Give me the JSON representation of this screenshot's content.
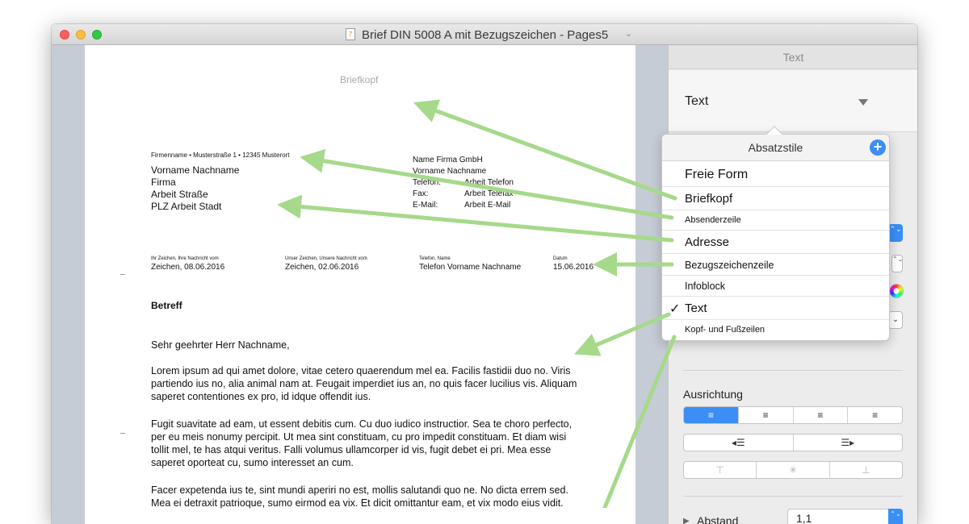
{
  "window": {
    "title": "Brief DIN 5008 A mit Bezugszeichen - Pages5",
    "chevron": "⌄",
    "doc_icon": "7"
  },
  "letter": {
    "header": "Briefkopf",
    "sender_line": "Firmenname • Musterstraße 1 • 12345 Musterort",
    "address": [
      "Vorname Nachname",
      "Firma",
      "Arbeit Straße",
      "PLZ Arbeit Stadt"
    ],
    "info_company": [
      "Name Firma GmbH",
      "Vorname Nachname"
    ],
    "info_labels": [
      "Telefon:",
      "Fax:",
      "E-Mail:"
    ],
    "info_values": [
      "Arbeit Telefon",
      "Arbeit Telefax",
      "Arbeit E-Mail"
    ],
    "ref_labels": [
      "Ihr Zeichen, Ihre Nachricht vom",
      "Unser Zeichen, Unsere Nachricht vom",
      "Telefon, Name",
      "Datum"
    ],
    "ref_values": [
      "Zeichen, 08.06.2016",
      "Zeichen, 02.06.2016",
      "Telefon Vorname Nachname",
      "15.06.2016"
    ],
    "subject": "Betreff",
    "salutation": "Sehr geehrter Herr Nachname,",
    "paragraphs": [
      [
        "Lorem ipsum ad qui amet dolore, vitae cetero quaerendum mel ea. Facilis fastidii duo no. Viris",
        "partiendo ius no, alia animal nam at. Feugait imperdiet ius an, no quis facer lucilius vis. Aliquam",
        "saperet contentiones ex pro, id idque offendit ius."
      ],
      [
        "Fugit suavitate ad eam, ut essent debitis cum. Cu duo iudico instructior. Sea te choro perfecto,",
        "per eu meis nonumy percipit. Ut mea sint constituam, cu pro impedit constituam. Et diam wisi",
        "tollit mel, te has atqui veritus. Falli volumus ullamcorper id vis, fugit debet ei pri. Mea esse",
        "saperet oporteat cu, sumo interesset an cum."
      ],
      [
        "Facer expetenda ius te, sint mundi aperiri no est, mollis salutandi quo ne. No dicta errem sed.",
        "Mea ei detraxit patrioque, sumo eirmod ea vix. Et dicit omittantur eam, et vix modo eius vidit."
      ]
    ]
  },
  "sidebar": {
    "tab": "Text",
    "style_name": "Text",
    "alignment_label": "Ausrichtung",
    "align_buttons": [
      "≡",
      "≡",
      "≡",
      "≡"
    ],
    "indent_buttons": [
      "◂☰",
      "☰▸"
    ],
    "vertical_buttons": [
      "⊤",
      "✳",
      "⊥"
    ],
    "spacing_toggle": "▶",
    "spacing_label": "Abstand",
    "spacing_value": "1,1",
    "stepper_glyph": "⌃⌄",
    "dropdown_glyph": "⌄"
  },
  "popover": {
    "title": "Absatzstile",
    "add_glyph": "+",
    "check_glyph": "✓",
    "items": [
      "Freie Form",
      "Briefkopf",
      "Absenderzeile",
      "Adresse",
      "Bezugszeichenzeile",
      "Infoblock",
      "Text",
      "Kopf- und Fußzeilen"
    ],
    "selected": "Text"
  },
  "colors": {
    "accent": "#3b8ef6",
    "arrow": "#a6d98a",
    "canvas": "#c6ccd6"
  }
}
